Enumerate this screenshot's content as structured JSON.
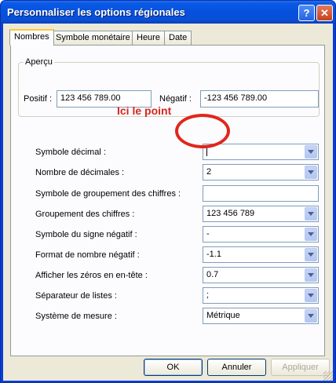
{
  "window": {
    "title": "Personnaliser les options régionales"
  },
  "titlebar_buttons": {
    "help": "?",
    "close": "✕"
  },
  "tabs": [
    {
      "label": "Nombres",
      "active": true
    },
    {
      "label": "Symbole monétaire",
      "active": false
    },
    {
      "label": "Heure",
      "active": false
    },
    {
      "label": "Date",
      "active": false
    }
  ],
  "preview": {
    "group_label": "Aperçu",
    "positive_label": "Positif :",
    "positive_value": "123 456 789.00",
    "negative_label": "Négatif :",
    "negative_value": "-123 456 789.00"
  },
  "annotation": {
    "text": "Ici le point",
    "color": "#d5261c"
  },
  "settings": [
    {
      "label": "Symbole décimal :",
      "value": ""
    },
    {
      "label": "Nombre de décimales :",
      "value": "2"
    },
    {
      "label": "Symbole de groupement des chiffres :",
      "value": ""
    },
    {
      "label": "Groupement des chiffres :",
      "value": "123 456 789"
    },
    {
      "label": "Symbole du signe négatif :",
      "value": "-"
    },
    {
      "label": "Format de nombre négatif :",
      "value": "-1.1"
    },
    {
      "label": "Afficher les zéros en en-tête :",
      "value": "0.7"
    },
    {
      "label": "Séparateur de listes :",
      "value": ";"
    },
    {
      "label": "Système de mesure :",
      "value": "Métrique"
    }
  ],
  "buttons": {
    "ok": "OK",
    "cancel": "Annuler",
    "apply": "Appliquer"
  },
  "colors": {
    "titlebar": "#0550dc",
    "dialog": "#ece9d8",
    "panel": "#fcfcfe"
  }
}
